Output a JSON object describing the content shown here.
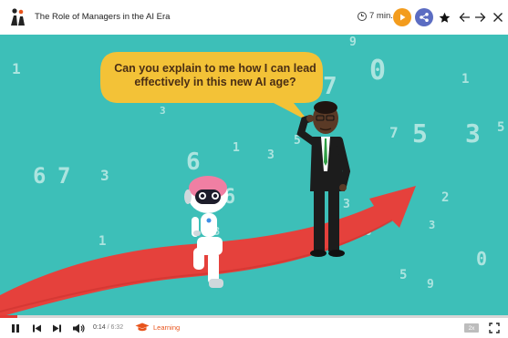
{
  "header": {
    "title": "The Role of Managers in the AI Era",
    "duration": "7 min.",
    "icons": [
      "logo-icon",
      "clock-icon",
      "play-icon",
      "share-icon",
      "star-icon",
      "back-arrow-icon",
      "forward-arrow-icon",
      "close-icon"
    ]
  },
  "video": {
    "speech_bubble": "Can you explain to me how I can lead effectively in this new AI age?",
    "background_digits": [
      "9",
      "0",
      "7",
      "3",
      "1",
      "1",
      "6",
      "3",
      "7",
      "6",
      "1",
      "3",
      "5",
      "3",
      "5",
      "5",
      "6",
      "7",
      "3",
      "2",
      "1",
      "3",
      "0",
      "5",
      "9",
      "0",
      "3"
    ]
  },
  "player": {
    "progress": 0.035,
    "current_time": "0:14",
    "total_time": "6:32",
    "learning_label": "Learning",
    "speed_label": "2x"
  },
  "colors": {
    "teal_background": "#3dbfb8",
    "arrow_red": "#e5413c",
    "bubble_yellow": "#f3c237",
    "accent_orange": "#f39c1d",
    "share_purple": "#5b6cc2",
    "learning_orange": "#e8541c"
  }
}
